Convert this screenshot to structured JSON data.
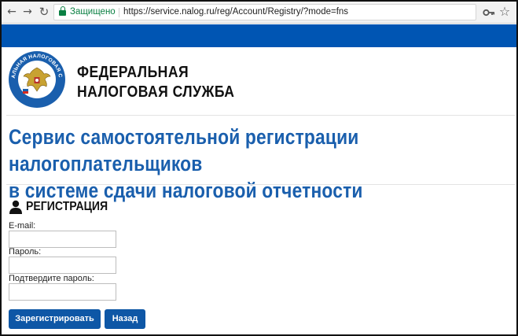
{
  "browser": {
    "back_glyph": "←",
    "forward_glyph": "→",
    "reload_glyph": "↻",
    "secure_label": "Защищено",
    "url": "https://service.nalog.ru/reg/Account/Registry/?mode=fns",
    "star_glyph": "☆"
  },
  "header": {
    "org_line1": "ФЕДЕРАЛЬНАЯ",
    "org_line2": "НАЛОГОВАЯ СЛУЖБА",
    "logo_text": "ФЕДЕРАЛЬНАЯ НАЛОГОВАЯ СЛУЖБА"
  },
  "page": {
    "title_line1": "Сервис самостоятельной регистрации налогоплательщиков",
    "title_line2": "в системе сдачи налоговой отчетности"
  },
  "form": {
    "heading": "РЕГИСТРАЦИЯ",
    "email_label": "E-mail:",
    "email_value": "",
    "password_label": "Пароль:",
    "password_value": "",
    "confirm_label": "Подтвердите пароль:",
    "confirm_value": "",
    "register_button": "Зарегистрировать",
    "back_button": "Назад"
  },
  "colors": {
    "brand_blue": "#0055b3",
    "title_blue": "#1a5fad",
    "button_blue": "#0e57a6",
    "secure_green": "#0b8043"
  }
}
